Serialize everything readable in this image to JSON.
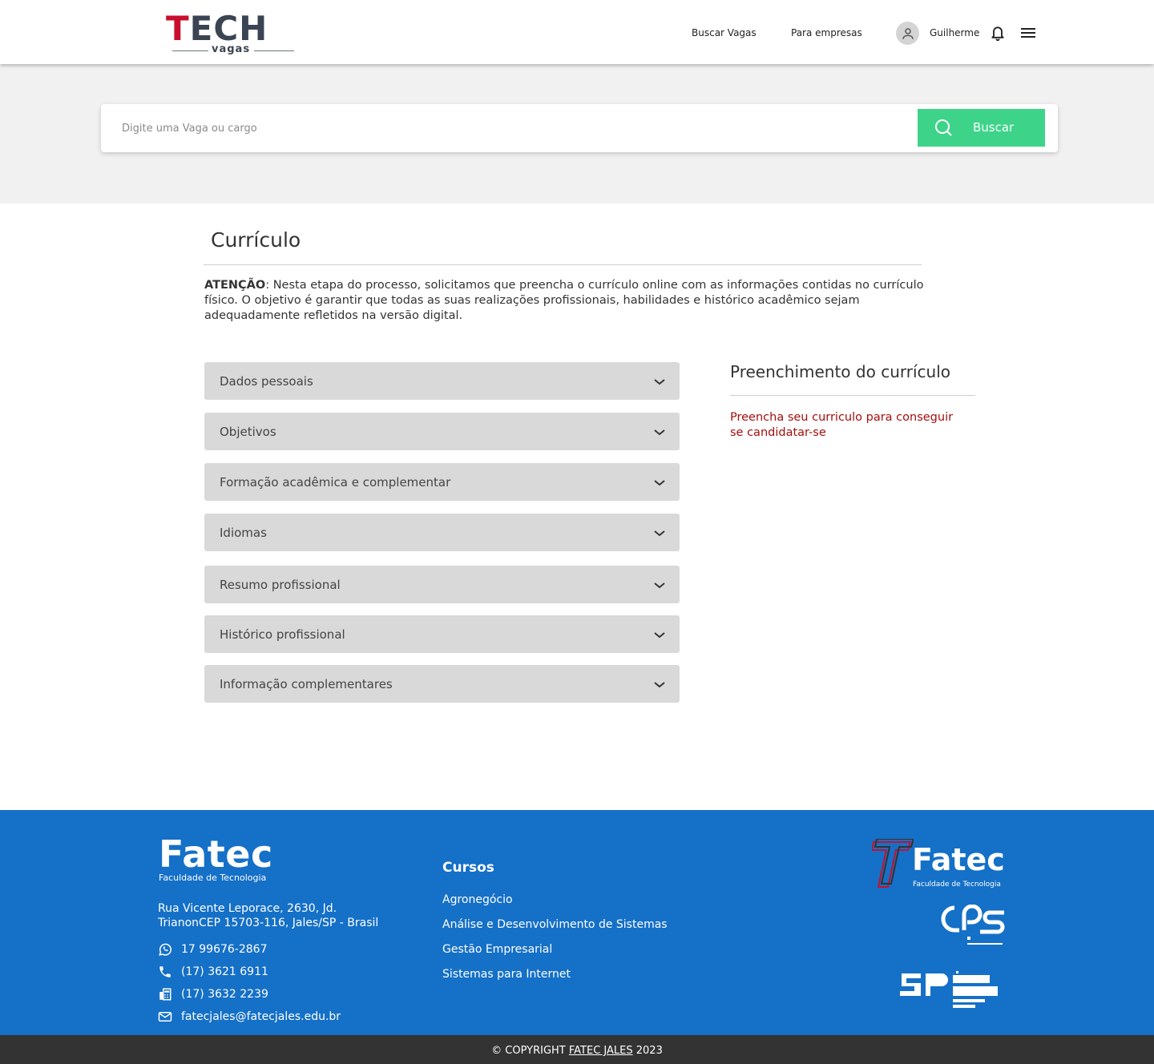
{
  "header": {
    "logo_main": "ECH",
    "logo_t": "T",
    "logo_sub": "vagas",
    "nav": [
      "Buscar Vagas",
      "Para empresas"
    ],
    "user_name": "Guilherme",
    "icons": {
      "avatar": "user-avatar-icon",
      "bell": "bell-icon",
      "menu": "hamburger-menu-icon"
    }
  },
  "search": {
    "placeholder": "Digite uma Vaga ou cargo",
    "button_label": "Buscar",
    "button_color": "#3dd48a"
  },
  "main": {
    "title": "Currículo",
    "attention_label": "ATENÇÃO",
    "attention_text": ": Nesta etapa do processo, solicitamos que preencha o currículo online com as informações contidas no currículo físico. O objetivo é garantir que todas as suas realizações profissionais, habilidades e histórico acadêmico sejam adequadamente refletidos na versão digital.",
    "sections": [
      "Dados pessoais",
      "Objetivos",
      "Formação acadêmica e complementar",
      "Idiomas",
      "Resumo profissional",
      "Histórico profissional",
      "Informação complementares"
    ]
  },
  "sidebar": {
    "title": "Preenchimento do currículo",
    "message": "Preencha seu curriculo para conseguir se candidatar-se",
    "message_color": "#a50d0d"
  },
  "footer": {
    "logo_main": "Fatec",
    "logo_sub": "Faculdade de Tecnologia",
    "address": "Rua Vicente Leporace, 2630, Jd. TrianonCEP 15703-116, Jales/SP - Brasil",
    "contacts": [
      {
        "icon": "whatsapp-icon",
        "text": "17 99676-2867"
      },
      {
        "icon": "phone-icon",
        "text": "(17) 3621 6911"
      },
      {
        "icon": "fax-icon",
        "text": "(17) 3632 2239"
      },
      {
        "icon": "mail-icon",
        "text": "fatecjales@fatecjales.edu.br"
      }
    ],
    "courses_title": "Cursos",
    "courses": [
      "Agronegócio",
      "Análise e Desenvolvimento de Sistemas",
      "Gestão Empresarial",
      "Sistemas para Internet"
    ],
    "partner_fatec": "Fatec",
    "partner_fatec_sub": "Faculdade de Tecnologia",
    "background": "#1570c7"
  },
  "copyright": {
    "prefix": "© COPYRIGHT ",
    "link": "FATEC JALES",
    "suffix": " 2023"
  }
}
